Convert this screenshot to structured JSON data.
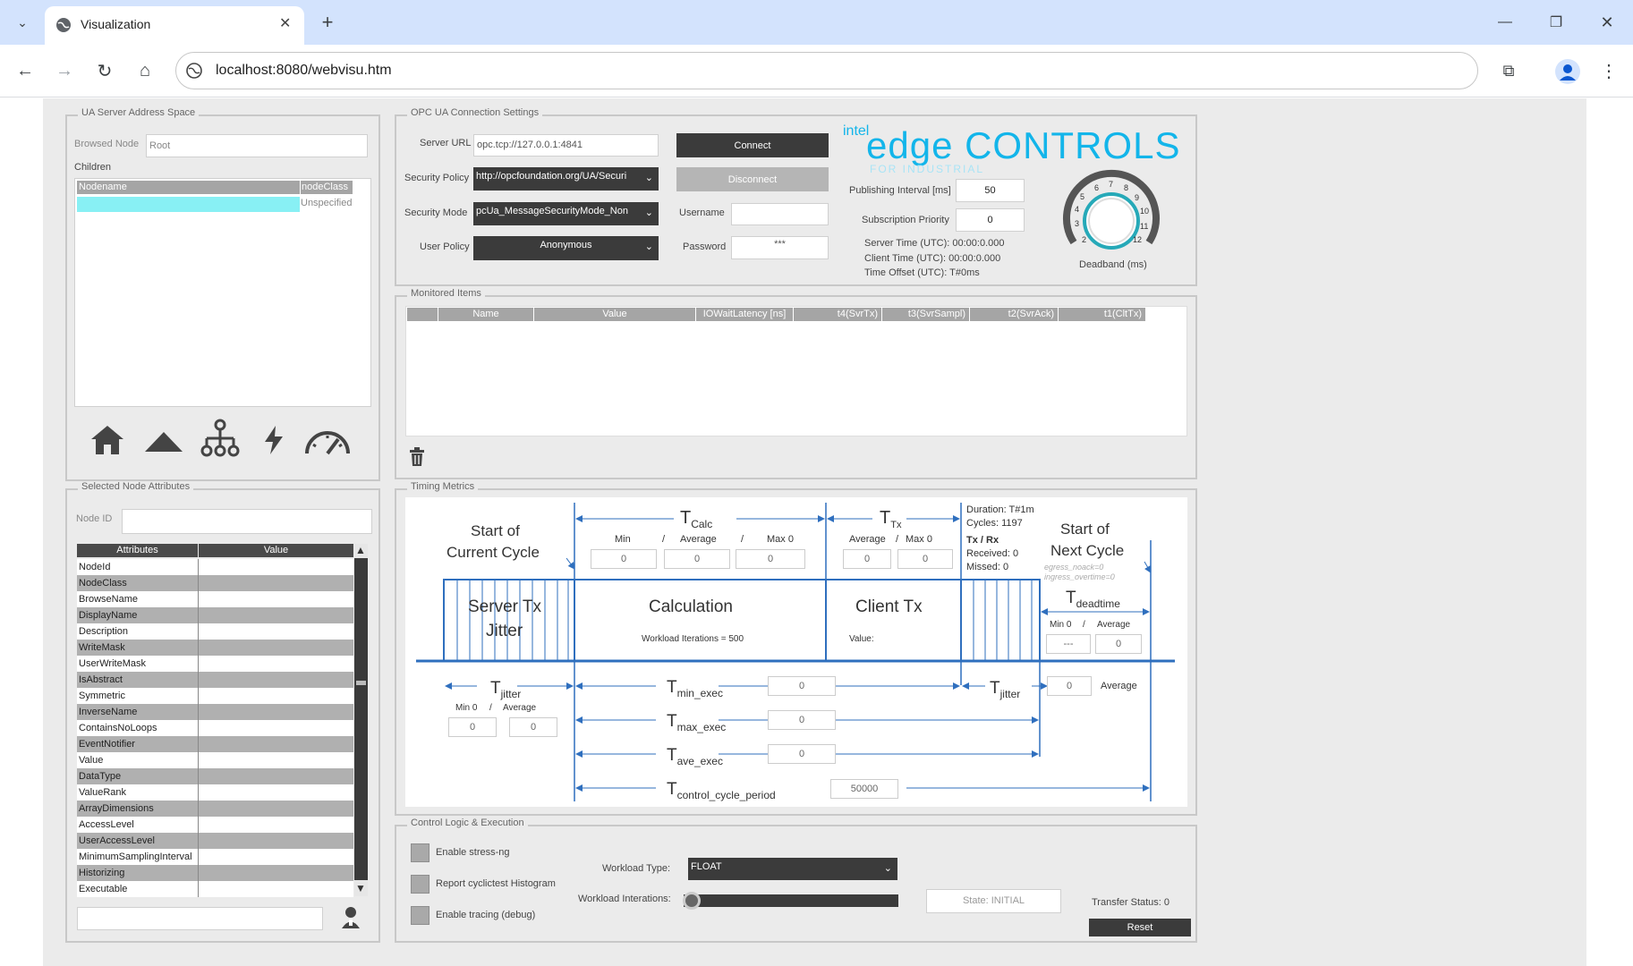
{
  "browser": {
    "tab_title": "Visualization",
    "url": "localhost:8080/webvisu.htm"
  },
  "ua_address_space": {
    "title": "UA Server Address Space",
    "browsed_node_label": "Browsed Node",
    "browsed_node_value": "Root",
    "children_label": "Children",
    "columns": [
      "Nodename",
      "nodeClass"
    ],
    "rows": [
      {
        "nodename": "",
        "nodeclass": "Unspecified"
      }
    ],
    "icons": [
      "home-icon",
      "up-triangle-icon",
      "hierarchy-icon",
      "lightning-icon",
      "gauge-icon"
    ]
  },
  "connection": {
    "title": "OPC UA Connection Settings",
    "server_url_label": "Server URL",
    "server_url": "opc.tcp://127.0.0.1:4841",
    "connect": "Connect",
    "disconnect": "Disconnect",
    "security_policy_label": "Security Policy",
    "security_policy": "http://opcfoundation.org/UA/Securi",
    "security_mode_label": "Security Mode",
    "security_mode": "pcUa_MessageSecurityMode_Non",
    "user_policy_label": "User Policy",
    "user_policy": "Anonymous",
    "username_label": "Username",
    "username": "",
    "password_label": "Password",
    "password": "***",
    "publishing_interval_label": "Publishing Interval [ms]",
    "publishing_interval": "50",
    "subscription_priority_label": "Subscription Priority",
    "subscription_priority": "0",
    "server_time": "Server Time (UTC): 00:00:0.000",
    "client_time": "Client Time (UTC): 00:00:0.000",
    "time_offset": "Time Offset (UTC): T#0ms",
    "deadband_label": "Deadband (ms)",
    "dial_ticks": [
      "2",
      "3",
      "4",
      "5",
      "6",
      "7",
      "8",
      "9",
      "10",
      "11",
      "12"
    ]
  },
  "logo": {
    "brand": "intel",
    "text": "edge CONTROLS",
    "sub": "FOR INDUSTRIAL"
  },
  "monitored": {
    "title": "Monitored Items",
    "columns": [
      "",
      "Name",
      "Value",
      "IOWaitLatency [ns]",
      "t4(SvrTx)",
      "t3(SvrSampl)",
      "t2(SvrAck)",
      "t1(CltTx)"
    ]
  },
  "timing": {
    "title": "Timing Metrics",
    "start_current": [
      "Start of",
      "Current Cycle"
    ],
    "start_next": [
      "Start of",
      "Next Cycle"
    ],
    "tcalc": "T",
    "tcalc_sub": "Calc",
    "ttx": "T",
    "ttx_sub": "Tx",
    "min_label": "Min",
    "avg_label": "Average",
    "max0_label": "Max 0",
    "slash": "/",
    "calc_min": "0",
    "calc_avg": "0",
    "calc_max": "0",
    "tx_avg": "0",
    "tx_max": "0",
    "duration": "Duration: T#1m",
    "cycles": "Cycles: 1197",
    "txrx": "Tx / Rx",
    "received": "Received: 0",
    "missed": "Missed: 0",
    "egress": "egress_noack=0",
    "ingress": "ingress_overtime=0",
    "server_tx_jitter": [
      "Server Tx",
      "Jitter"
    ],
    "calculation": "Calculation",
    "workload_iter": "Workload Iterations = 500",
    "client_tx": "Client Tx",
    "value_label": "Value:",
    "tdeadtime": "T",
    "tdeadtime_sub": "deadtime",
    "min0_label": "Min 0",
    "dead_min": "---",
    "dead_avg": "0",
    "tjitter": "T",
    "tjitter_sub": "jitter",
    "jitter_min": "0",
    "jitter_avg": "0",
    "jitter2_val": "0",
    "average_label": "Average",
    "tmin_exec_sub": "min_exec",
    "tmin_exec": "0",
    "tmax_exec_sub": "max_exec",
    "tmax_exec": "0",
    "tave_exec_sub": "ave_exec",
    "tave_exec": "0",
    "tccp_sub": "control_cycle_period",
    "tccp": "50000"
  },
  "attributes": {
    "title": "Selected Node Attributes",
    "node_id_label": "Node ID",
    "node_id": "",
    "columns": [
      "Attributes",
      "Value"
    ],
    "rows": [
      "NodeId",
      "NodeClass",
      "BrowseName",
      "DisplayName",
      "Description",
      "WriteMask",
      "UserWriteMask",
      "IsAbstract",
      "Symmetric",
      "InverseName",
      "ContainsNoLoops",
      "EventNotifier",
      "Value",
      "DataType",
      "ValueRank",
      "ArrayDimensions",
      "AccessLevel",
      "UserAccessLevel",
      "MinimumSamplingInterval",
      "Historizing",
      "Executable"
    ],
    "bottom_input": ""
  },
  "control": {
    "title": "Control Logic & Execution",
    "stress": "Enable stress-ng",
    "histogram": "Report cyclictest Histogram",
    "tracing": "Enable tracing (debug)",
    "workload_type_label": "Workload Type:",
    "workload_type": "FLOAT",
    "workload_iter_label": "Workload Interations:",
    "state": "State: INITIAL",
    "transfer_status": "Transfer Status: 0",
    "reset": "Reset"
  }
}
